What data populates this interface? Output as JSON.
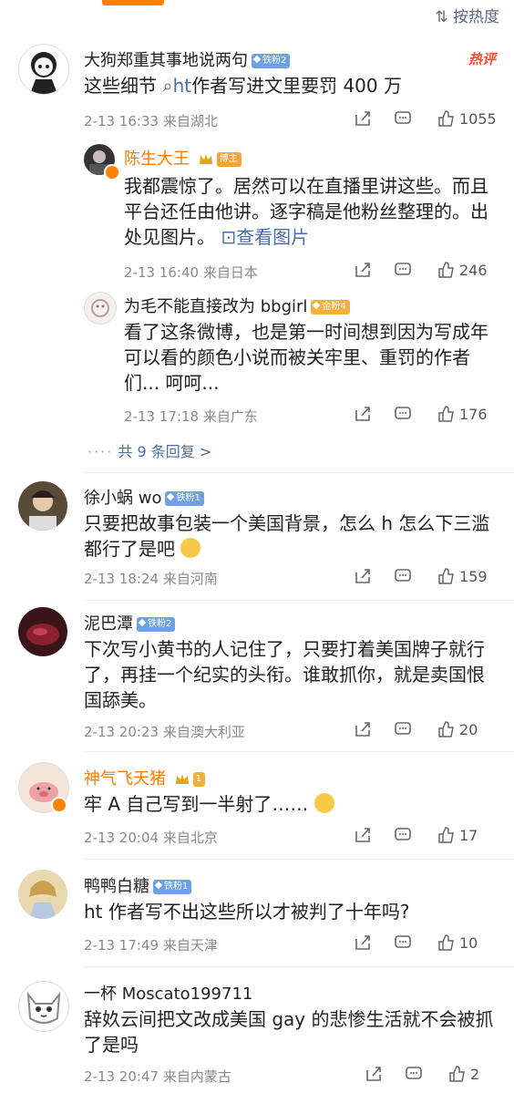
{
  "header": {
    "sort_label": "按热度"
  },
  "comments": [
    {
      "name": "大狗郑重其事地说两句",
      "badge": "铁粉2",
      "hot_tag": "热评",
      "text_pre": "这些细节 ",
      "text_link": "ht",
      "text_post": "作者写进文里要罚 400 万",
      "date": "2-13 16:33",
      "location": "来自湖北",
      "likes": "1055",
      "replies": [
        {
          "name": "陈生大王",
          "badge": "博主",
          "text": "我都震惊了。居然可以在直播里讲这些。而且平台还任由他讲。逐字稿是他粉丝整理的。出处见图片。",
          "link": "查看图片",
          "date": "2-13 16:40",
          "location": "来自日本",
          "likes": "246"
        },
        {
          "name": "为毛不能直接改为 bbgirl",
          "badge": "金粉4",
          "text": "看了这条微博，也是第一时间想到因为写成年可以看的颜色小说而被关牢里、重罚的作者们... 呵呵...",
          "date": "2-13 17:18",
          "location": "来自广东",
          "likes": "176"
        }
      ],
      "more_replies": "共 9 条回复 >"
    },
    {
      "name": "徐小蜗 wo",
      "badge": "铁粉1",
      "text": "只要把故事包装一个美国背景，怎么 h 怎么下三滥都行了是吧",
      "date": "2-13 18:24",
      "location": "来自河南",
      "likes": "159"
    },
    {
      "name": "泥巴潭",
      "badge": "铁粉2",
      "text": "下次写小黄书的人记住了，只要打着美国牌子就行了，再挂一个纪实的头衔。谁敢抓你，就是卖国恨国舔美。",
      "date": "2-13 20:23",
      "location": "来自澳大利亚",
      "likes": "20"
    },
    {
      "name": "神气飞天猪",
      "badge": "1",
      "text": "牢 A 自己写到一半射了……",
      "date": "2-13 20:04",
      "location": "来自北京",
      "likes": "17"
    },
    {
      "name": "鸭鸭白糖",
      "badge": "铁粉1",
      "text": "ht 作者写不出这些所以才被判了十年吗?",
      "date": "2-13 17:49",
      "location": "来自天津",
      "likes": "10"
    },
    {
      "name": "一杯 Moscato199711",
      "text": "辞奺云间把文改成美国 gay 的悲惨生活就不会被抓了是吗",
      "date": "2-13 20:47",
      "location": "来自内蒙古",
      "likes": "2"
    }
  ],
  "colors": {
    "accent": "#ff8200",
    "link": "#4a6ea8",
    "badge_blue": "#6ea0e6",
    "badge_gold": "#f2b23a",
    "hot": "#ff4a2a"
  },
  "icons": [
    "share-icon",
    "comment-icon",
    "like-icon",
    "search-icon",
    "image-icon",
    "sort-icon",
    "crown-icon"
  ]
}
